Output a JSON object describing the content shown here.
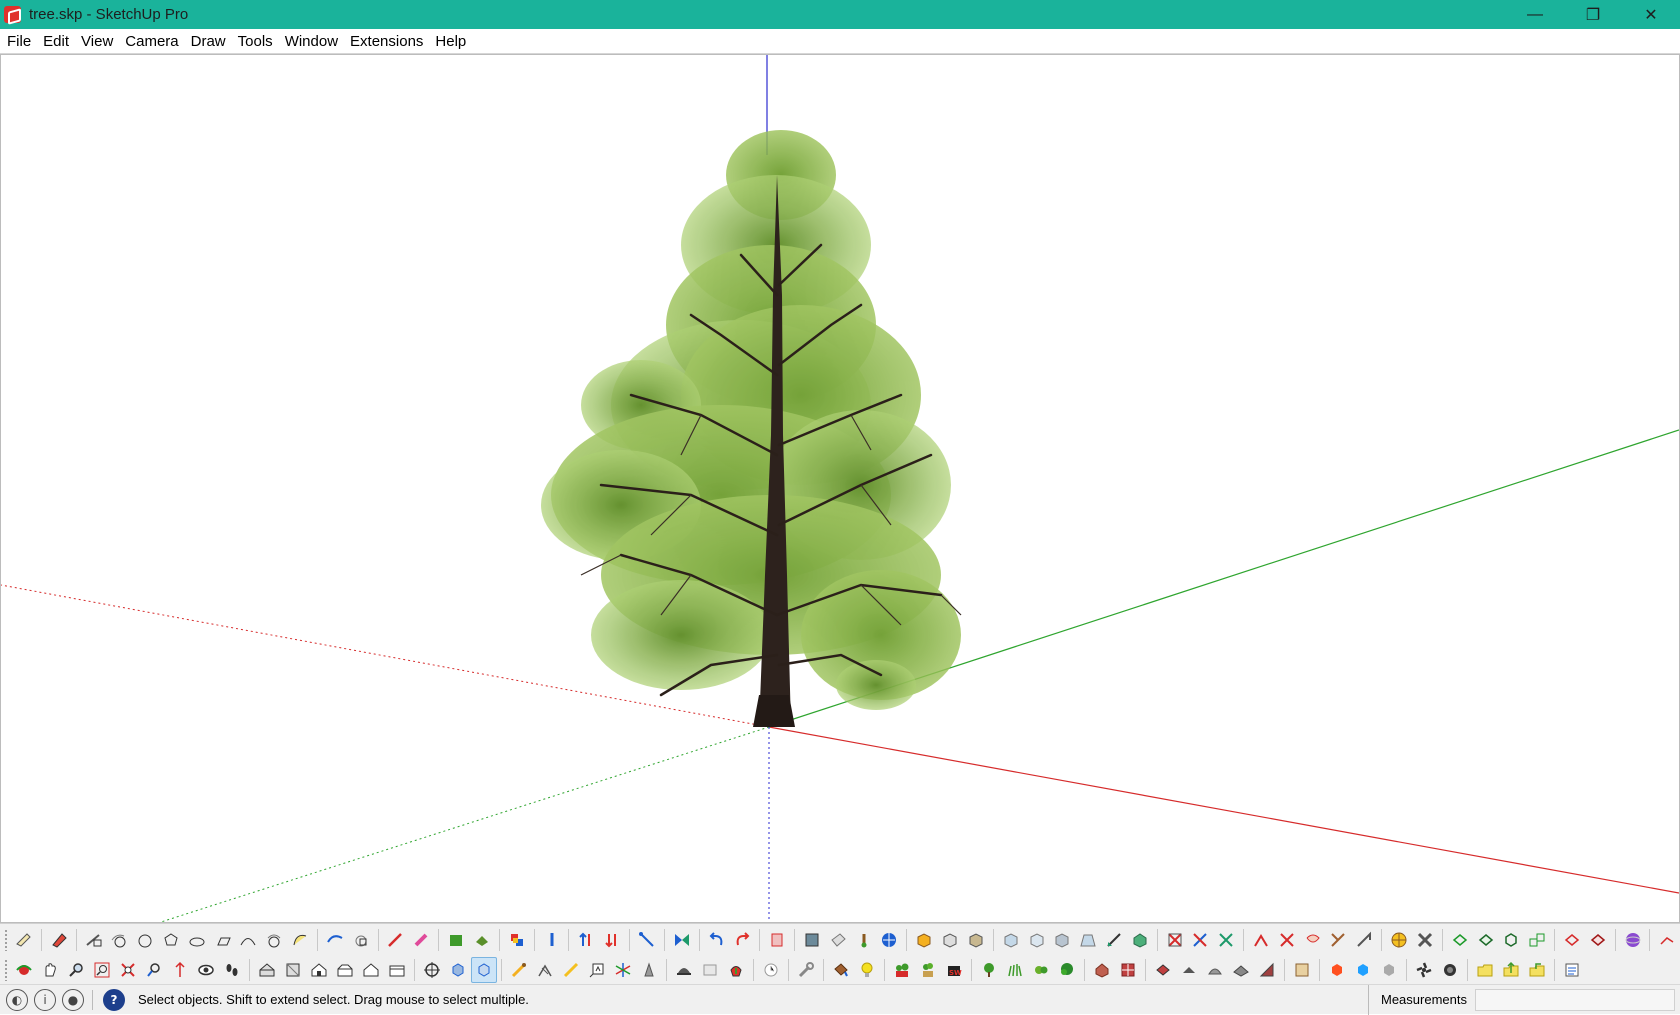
{
  "window": {
    "title": "tree.skp - SketchUp Pro",
    "controls": {
      "minimize": "—",
      "maximize": "❐",
      "close": "✕"
    }
  },
  "menu": [
    "File",
    "Edit",
    "View",
    "Camera",
    "Draw",
    "Tools",
    "Window",
    "Extensions",
    "Help"
  ],
  "viewport": {
    "model": "tree",
    "axis_colors": {
      "red": "#d62b2b",
      "green": "#2fa52f",
      "blue": "#2a2ad0"
    }
  },
  "toolbar_row1": [
    "select-icon",
    "eraser-icon",
    "paint-bucket-icon",
    "line-icon",
    "freehand-icon",
    "rectangle-icon",
    "rotated-rectangle-icon",
    "circle-icon",
    "polygon-icon",
    "arc-icon",
    "2pt-arc-icon",
    "3pt-arc-icon",
    "pie-icon",
    "push-pull-icon",
    "follow-me-icon",
    "offset-icon",
    "move-icon",
    "rotate-icon",
    "scale-icon",
    "tape-measure-icon",
    "dimension-icon",
    "protractor-icon",
    "text-icon",
    "axes-icon",
    "3d-text-icon",
    "components-icon",
    "groups-icon",
    "section-plane-icon",
    "section-fill-icon",
    "sandbox-icon",
    "contours-icon",
    "smoove-icon",
    "stamp-icon",
    "drape-icon",
    "add-detail-icon",
    "flip-edge-icon",
    "warehouse-icon",
    "extension-warehouse-icon",
    "layout-icon",
    "solid-outer-shell-icon",
    "intersect-icon",
    "union-icon",
    "subtract-icon",
    "trim-icon",
    "split-icon",
    "geo-location-icon",
    "photo-texture-icon",
    "style-xray-icon",
    "style-backedges-icon",
    "style-wireframe-icon",
    "style-hidden-icon",
    "style-shaded-icon",
    "style-textured-icon",
    "style-monochrome-icon"
  ],
  "toolbar_row2": [
    "orbit-icon",
    "pan-icon",
    "zoom-icon",
    "zoom-window-icon",
    "zoom-extents-icon",
    "previous-view-icon",
    "position-camera-icon",
    "look-around-icon",
    "walk-icon",
    "iso-view-icon",
    "top-view-icon",
    "front-view-icon",
    "right-view-icon",
    "back-view-icon",
    "left-view-icon",
    "x-ray-icon",
    "back-edges-icon",
    "wireframe-icon",
    "shadows-icon",
    "fog-icon",
    "edge-style-icon",
    "profiles-icon",
    "plants-icon",
    "trees-icon",
    "render-icon"
  ],
  "status": {
    "message": "Select objects. Shift to extend select. Drag mouse to select multiple.",
    "measurements_label": "Measurements",
    "measurements_value": ""
  }
}
